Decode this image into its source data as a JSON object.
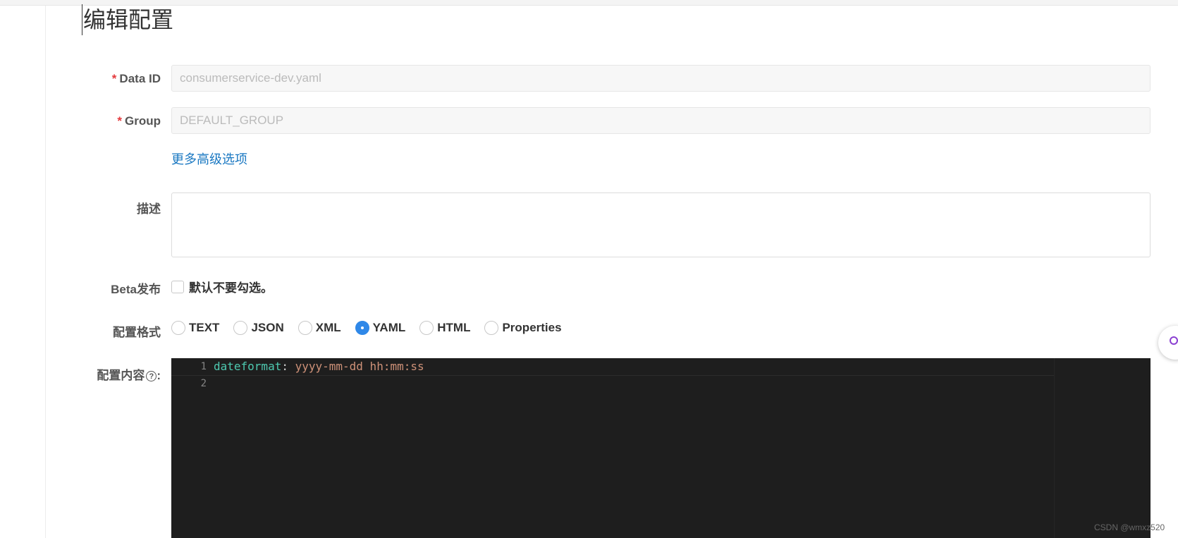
{
  "page": {
    "title": "编辑配置"
  },
  "form": {
    "data_id": {
      "label": "Data ID",
      "required_mark": "*",
      "value": "consumerservice-dev.yaml"
    },
    "group": {
      "label": "Group",
      "required_mark": "*",
      "value": "DEFAULT_GROUP"
    },
    "advanced_link": "更多高级选项",
    "description": {
      "label": "描述",
      "value": ""
    },
    "beta": {
      "label": "Beta发布",
      "checkbox_label": "默认不要勾选。",
      "checked": false
    },
    "format": {
      "label": "配置格式",
      "options": [
        "TEXT",
        "JSON",
        "XML",
        "YAML",
        "HTML",
        "Properties"
      ],
      "selected": "YAML"
    },
    "content": {
      "label": "配置内容",
      "help_icon": "question-circle-icon",
      "colon": ":",
      "lines": [
        {
          "number": "1",
          "key": "dateformat",
          "sep": ": ",
          "value": "yyyy-mm-dd hh:mm:ss"
        },
        {
          "number": "2",
          "key": "",
          "sep": "",
          "value": ""
        }
      ]
    }
  },
  "colors": {
    "accent": "#2f88e8",
    "link": "#1a78c2",
    "required": "#e4393c",
    "editor_bg": "#1e1e1e",
    "yaml_key": "#4ec9b0",
    "yaml_value": "#ce9178"
  },
  "watermark": "CSDN @wmxz520"
}
